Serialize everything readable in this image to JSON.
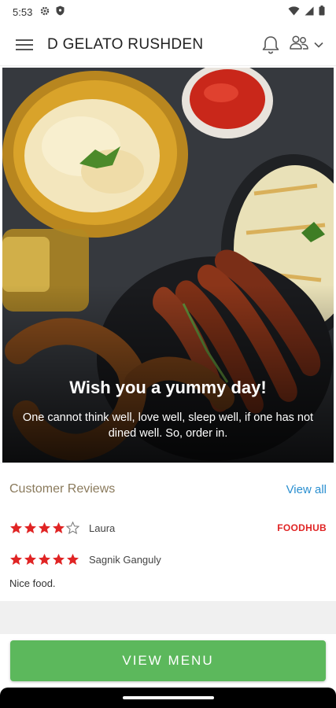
{
  "status_bar": {
    "time": "5:53"
  },
  "app_bar": {
    "title": "D GELATO RUSHDEN"
  },
  "hero": {
    "title": "Wish you a yummy day!",
    "subtitle": "One cannot think well, love well, sleep well, if one has not dined well. So, order in."
  },
  "reviews": {
    "title": "Customer Reviews",
    "view_all_label": "View all",
    "items": [
      {
        "rating": 4,
        "max_rating": 5,
        "name": "Laura",
        "source": "FOODHUB",
        "text": ""
      },
      {
        "rating": 5,
        "max_rating": 5,
        "name": "Sagnik Ganguly",
        "source": "",
        "text": "Nice food."
      }
    ]
  },
  "view_menu_label": "VIEW MENU",
  "colors": {
    "accent_green": "#5cb85c",
    "star_red": "#e02424",
    "link_blue": "#2a8fd0",
    "reviews_title": "#8a7a5c"
  }
}
